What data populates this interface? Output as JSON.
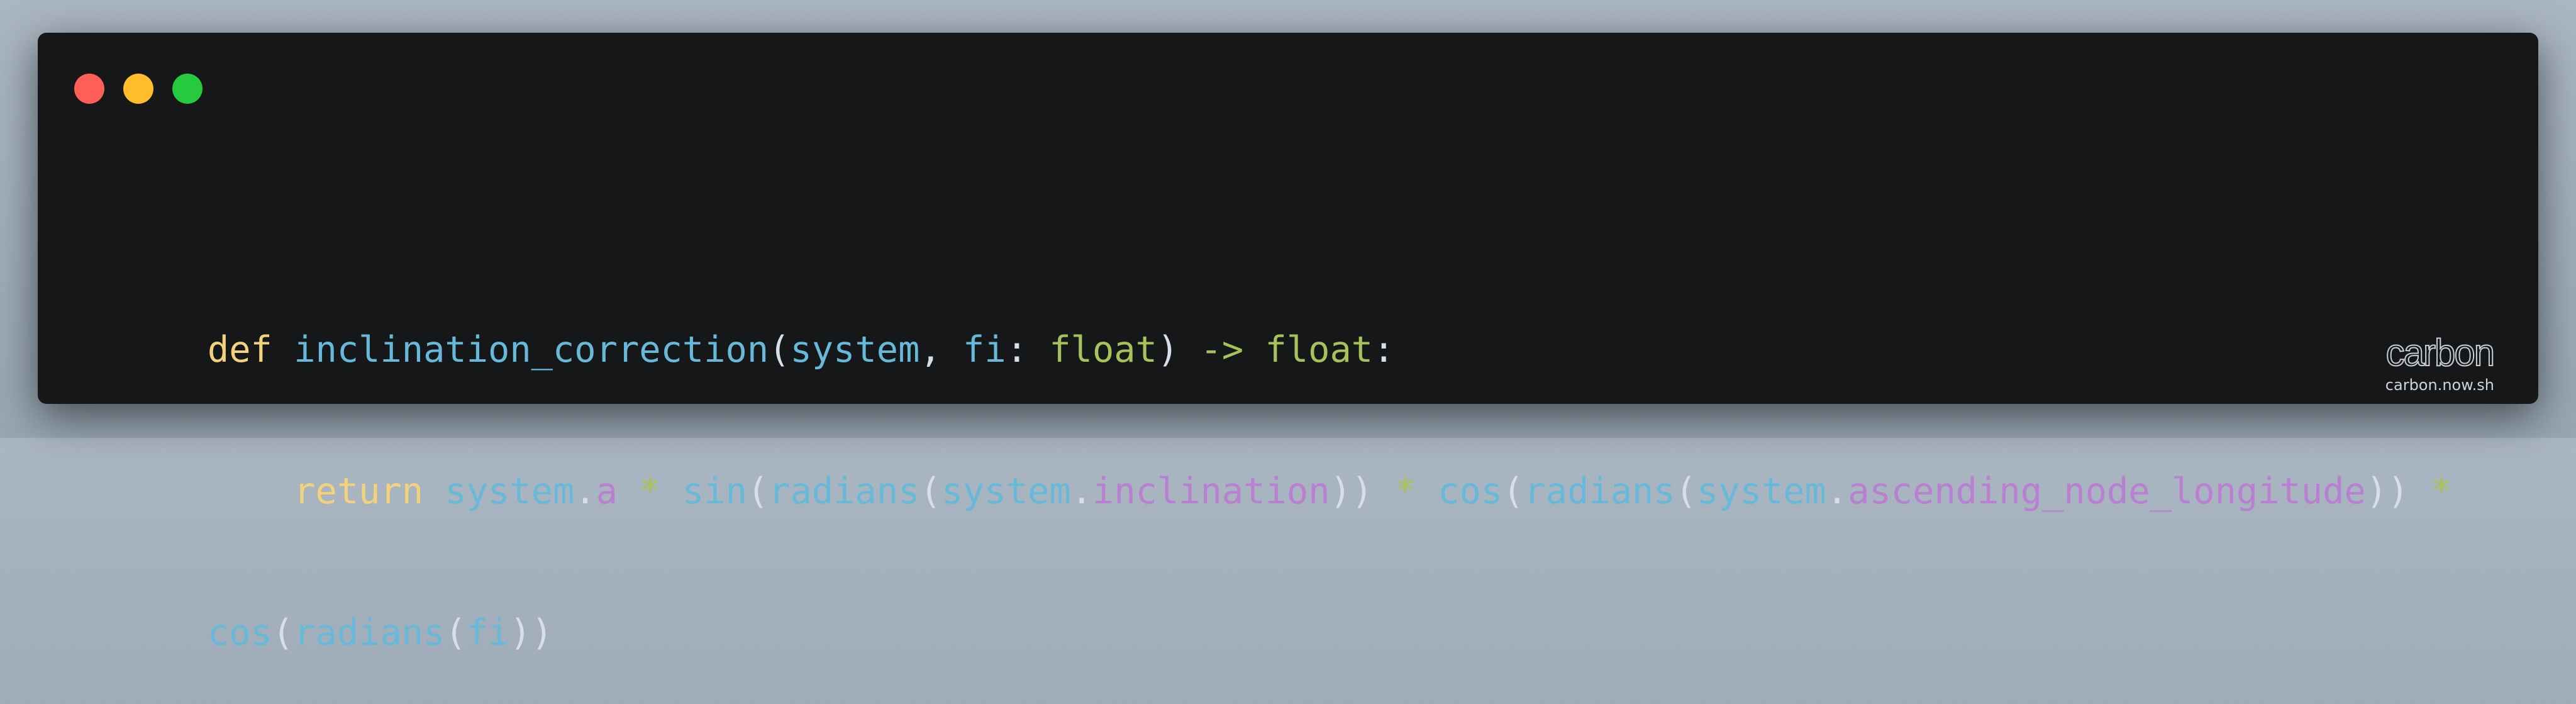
{
  "window": {
    "traffic_lights": [
      "close",
      "minimize",
      "zoom"
    ],
    "background": "#151718"
  },
  "code": {
    "language": "python",
    "lines": [
      [
        {
          "text": "def",
          "kind": "keyword"
        },
        {
          "text": " ",
          "kind": "space"
        },
        {
          "text": "inclination_correction",
          "kind": "function"
        },
        {
          "text": "(",
          "kind": "punctuation"
        },
        {
          "text": "system",
          "kind": "function"
        },
        {
          "text": ", ",
          "kind": "punctuation"
        },
        {
          "text": "fi",
          "kind": "function"
        },
        {
          "text": ": ",
          "kind": "punctuation"
        },
        {
          "text": "float",
          "kind": "type"
        },
        {
          "text": ") ",
          "kind": "punctuation"
        },
        {
          "text": "->",
          "kind": "operator"
        },
        {
          "text": " ",
          "kind": "space"
        },
        {
          "text": "float",
          "kind": "type"
        },
        {
          "text": ":",
          "kind": "punctuation"
        }
      ],
      [
        {
          "text": "    ",
          "kind": "space"
        },
        {
          "text": "return",
          "kind": "keyword"
        },
        {
          "text": " ",
          "kind": "space"
        },
        {
          "text": "system",
          "kind": "function"
        },
        {
          "text": ".",
          "kind": "punctuation"
        },
        {
          "text": "a",
          "kind": "attribute"
        },
        {
          "text": " ",
          "kind": "space"
        },
        {
          "text": "*",
          "kind": "operator"
        },
        {
          "text": " ",
          "kind": "space"
        },
        {
          "text": "sin",
          "kind": "function"
        },
        {
          "text": "(",
          "kind": "punctuation"
        },
        {
          "text": "radians",
          "kind": "function"
        },
        {
          "text": "(",
          "kind": "punctuation"
        },
        {
          "text": "system",
          "kind": "function"
        },
        {
          "text": ".",
          "kind": "punctuation"
        },
        {
          "text": "inclination",
          "kind": "attribute"
        },
        {
          "text": ")) ",
          "kind": "punctuation"
        },
        {
          "text": "*",
          "kind": "operator"
        },
        {
          "text": " ",
          "kind": "space"
        },
        {
          "text": "cos",
          "kind": "function"
        },
        {
          "text": "(",
          "kind": "punctuation"
        },
        {
          "text": "radians",
          "kind": "function"
        },
        {
          "text": "(",
          "kind": "punctuation"
        },
        {
          "text": "system",
          "kind": "function"
        },
        {
          "text": ".",
          "kind": "punctuation"
        },
        {
          "text": "ascending_node_longitude",
          "kind": "attribute"
        },
        {
          "text": ")) ",
          "kind": "punctuation"
        },
        {
          "text": "*",
          "kind": "operator"
        }
      ],
      [
        {
          "text": "cos",
          "kind": "function"
        },
        {
          "text": "(",
          "kind": "punctuation"
        },
        {
          "text": "radians",
          "kind": "function"
        },
        {
          "text": "(",
          "kind": "punctuation"
        },
        {
          "text": "fi",
          "kind": "function"
        },
        {
          "text": "))",
          "kind": "punctuation"
        }
      ]
    ]
  },
  "watermark": {
    "logo": "carbon",
    "url": "carbon.now.sh"
  },
  "colors": {
    "keyword": "#f2d27a",
    "function": "#66b9d8",
    "type": "#a7c25a",
    "operator": "#a7c25a",
    "attribute": "#b97fd0",
    "punctuation": "#d8dee9",
    "close": "#ff5f56",
    "minimize": "#ffbd2e",
    "zoom": "#27c93f"
  }
}
